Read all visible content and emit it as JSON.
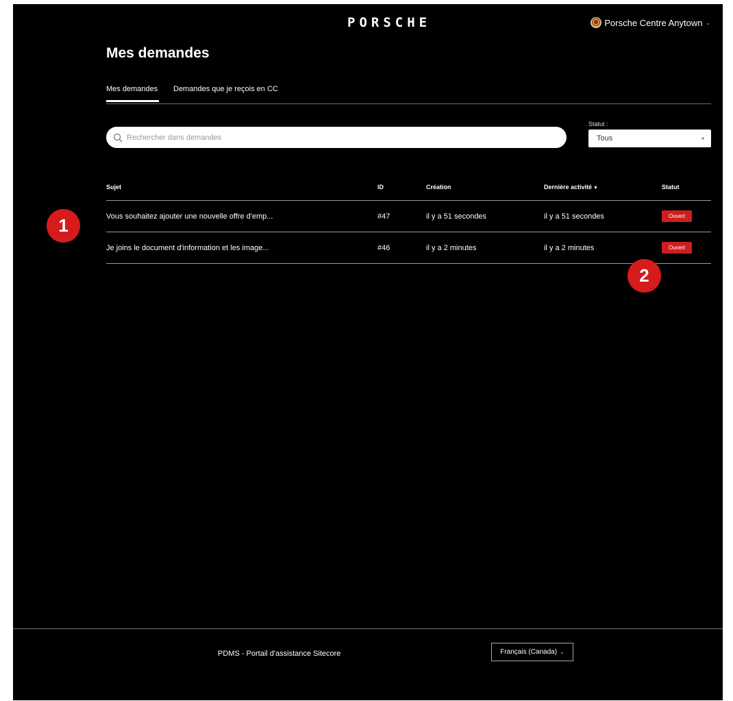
{
  "header": {
    "logo_text": "PORSCHE",
    "account_name": "Porsche Centre Anytown",
    "account_chevron": "⌄"
  },
  "page": {
    "title": "Mes demandes"
  },
  "tabs": [
    {
      "label": "Mes demandes",
      "active": true
    },
    {
      "label": "Demandes que je reçois en CC",
      "active": false
    }
  ],
  "search": {
    "placeholder": "Rechercher dans demandes",
    "value": ""
  },
  "status_filter": {
    "label": "Statut :",
    "selected": "Tous"
  },
  "table": {
    "columns": {
      "subject": "Sujet",
      "id": "ID",
      "created": "Création",
      "activity": "Dernière activité",
      "status": "Statut"
    },
    "rows": [
      {
        "subject": "Vous souhaitez ajouter une nouvelle offre d'emp...",
        "id": "#47",
        "created": "il y a 51 secondes",
        "activity": "il y a 51 secondes",
        "status": "Ouvert"
      },
      {
        "subject": "Je joins le document d'information et les image...",
        "id": "#46",
        "created": "il y a 2 minutes",
        "activity": "il y a 2 minutes",
        "status": "Ouvert"
      }
    ]
  },
  "callouts": [
    "1",
    "2"
  ],
  "footer": {
    "site_name": "PDMS - Portail d'assistance Sitecore",
    "language": "Français (Canada)"
  },
  "colors": {
    "background": "#000000",
    "badge_red": "#cc1f1f",
    "callout_red": "#d51b1b"
  }
}
